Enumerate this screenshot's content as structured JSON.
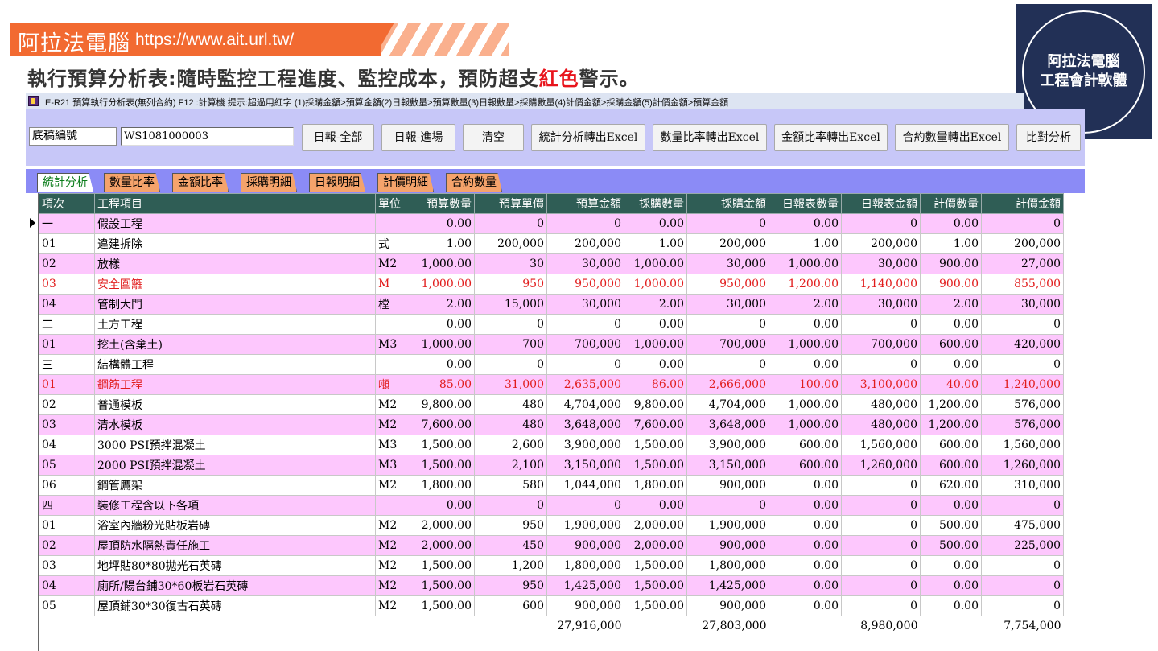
{
  "banner": {
    "title": "阿拉法電腦",
    "url": "https://www.ait.url.tw/"
  },
  "headline": {
    "part1": "執行預算分析表:隨時監控工程進度、監控成本，預防超支",
    "red": "紅色",
    "part2": "警示。"
  },
  "logo": {
    "line1": "阿拉法電腦",
    "line2": "工程會計軟體"
  },
  "window": {
    "title": "E-R21 預算執行分析表(無列合約)   F12 :計算機  提示:超過用紅字 (1)採購金額>預算金額(2)日報數量>預算數量(3)日報數量>採購數量(4)計價金額>採購金額(5)計價金額>預算金額"
  },
  "toolbar": {
    "label": "底稿編號",
    "input_value": "WS1081000003",
    "buttons": [
      "日報-全部",
      "日報-進場",
      "清空",
      "統計分析轉出Excel",
      "數量比率轉出Excel",
      "金額比率轉出Excel",
      "合約數量轉出Excel",
      "比對分析"
    ]
  },
  "tabs": [
    "統計分析",
    "數量比率",
    "金額比率",
    "採購明細",
    "日報明細",
    "計價明細",
    "合約數量"
  ],
  "grid": {
    "columns": [
      "項次",
      "工程項目",
      "單位",
      "預算數量",
      "預算單價",
      "預算金額",
      "採購數量",
      "採購金額",
      "日報表數量",
      "日報表金額",
      "計價數量",
      "計價金額"
    ],
    "rows": [
      {
        "c": [
          "一",
          "假設工程",
          "",
          "0.00",
          "0",
          "0",
          "0.00",
          "0",
          "0.00",
          "0",
          "0.00",
          "0"
        ],
        "style": "pink",
        "red": false
      },
      {
        "c": [
          "01",
          "違建拆除",
          "式",
          "1.00",
          "200,000",
          "200,000",
          "1.00",
          "200,000",
          "1.00",
          "200,000",
          "1.00",
          "200,000"
        ],
        "style": "white",
        "red": false
      },
      {
        "c": [
          "02",
          "放樣",
          "M2",
          "1,000.00",
          "30",
          "30,000",
          "1,000.00",
          "30,000",
          "1,000.00",
          "30,000",
          "900.00",
          "27,000"
        ],
        "style": "pink",
        "red": false
      },
      {
        "c": [
          "03",
          "安全圍籬",
          "M",
          "1,000.00",
          "950",
          "950,000",
          "1,000.00",
          "950,000",
          "1,200.00",
          "1,140,000",
          "900.00",
          "855,000"
        ],
        "style": "white",
        "red": true
      },
      {
        "c": [
          "04",
          "管制大門",
          "樘",
          "2.00",
          "15,000",
          "30,000",
          "2.00",
          "30,000",
          "2.00",
          "30,000",
          "2.00",
          "30,000"
        ],
        "style": "pink",
        "red": false
      },
      {
        "c": [
          "二",
          "土方工程",
          "",
          "0.00",
          "0",
          "0",
          "0.00",
          "0",
          "0.00",
          "0",
          "0.00",
          "0"
        ],
        "style": "white",
        "red": false
      },
      {
        "c": [
          "01",
          "挖土(含棄土)",
          "M3",
          "1,000.00",
          "700",
          "700,000",
          "1,000.00",
          "700,000",
          "1,000.00",
          "700,000",
          "600.00",
          "420,000"
        ],
        "style": "pink",
        "red": false
      },
      {
        "c": [
          "三",
          "結構體工程",
          "",
          "0.00",
          "0",
          "0",
          "0.00",
          "0",
          "0.00",
          "0",
          "0.00",
          "0"
        ],
        "style": "white",
        "red": false
      },
      {
        "c": [
          "01",
          "鋼筋工程",
          "噸",
          "85.00",
          "31,000",
          "2,635,000",
          "86.00",
          "2,666,000",
          "100.00",
          "3,100,000",
          "40.00",
          "1,240,000"
        ],
        "style": "pink",
        "red": true
      },
      {
        "c": [
          "02",
          "普通模板",
          "M2",
          "9,800.00",
          "480",
          "4,704,000",
          "9,800.00",
          "4,704,000",
          "1,000.00",
          "480,000",
          "1,200.00",
          "576,000"
        ],
        "style": "white",
        "red": false
      },
      {
        "c": [
          "03",
          "清水模板",
          "M2",
          "7,600.00",
          "480",
          "3,648,000",
          "7,600.00",
          "3,648,000",
          "1,000.00",
          "480,000",
          "1,200.00",
          "576,000"
        ],
        "style": "pink",
        "red": false
      },
      {
        "c": [
          "04",
          "3000 PSI預拌混凝土",
          "M3",
          "1,500.00",
          "2,600",
          "3,900,000",
          "1,500.00",
          "3,900,000",
          "600.00",
          "1,560,000",
          "600.00",
          "1,560,000"
        ],
        "style": "white",
        "red": false
      },
      {
        "c": [
          "05",
          "2000 PSI預拌混凝土",
          "M3",
          "1,500.00",
          "2,100",
          "3,150,000",
          "1,500.00",
          "3,150,000",
          "600.00",
          "1,260,000",
          "600.00",
          "1,260,000"
        ],
        "style": "pink",
        "red": false
      },
      {
        "c": [
          "06",
          "鋼管鷹架",
          "M2",
          "1,800.00",
          "580",
          "1,044,000",
          "1,800.00",
          "900,000",
          "0.00",
          "0",
          "620.00",
          "310,000"
        ],
        "style": "white",
        "red": false
      },
      {
        "c": [
          "四",
          "裝修工程含以下各項",
          "",
          "0.00",
          "0",
          "0",
          "0.00",
          "0",
          "0.00",
          "0",
          "0.00",
          "0"
        ],
        "style": "pink",
        "red": false
      },
      {
        "c": [
          "01",
          "浴室內牆粉光貼板岩磚",
          "M2",
          "2,000.00",
          "950",
          "1,900,000",
          "2,000.00",
          "1,900,000",
          "0.00",
          "0",
          "500.00",
          "475,000"
        ],
        "style": "white",
        "red": false
      },
      {
        "c": [
          "02",
          "屋頂防水隔熱責任施工",
          "M2",
          "2,000.00",
          "450",
          "900,000",
          "2,000.00",
          "900,000",
          "0.00",
          "0",
          "500.00",
          "225,000"
        ],
        "style": "pink",
        "red": false
      },
      {
        "c": [
          "03",
          "地坪貼80*80拋光石英磚",
          "M2",
          "1,500.00",
          "1,200",
          "1,800,000",
          "1,500.00",
          "1,800,000",
          "0.00",
          "0",
          "0.00",
          "0"
        ],
        "style": "white",
        "red": false
      },
      {
        "c": [
          "04",
          "廁所/陽台鋪30*60板岩石英磚",
          "M2",
          "1,500.00",
          "950",
          "1,425,000",
          "1,500.00",
          "1,425,000",
          "0.00",
          "0",
          "0.00",
          "0"
        ],
        "style": "pink",
        "red": false
      },
      {
        "c": [
          "05",
          "屋頂鋪30*30復古石英磚",
          "M2",
          "1,500.00",
          "600",
          "900,000",
          "1,500.00",
          "900,000",
          "0.00",
          "0",
          "0.00",
          "0"
        ],
        "style": "white",
        "red": false
      }
    ],
    "totals": [
      "",
      "",
      "",
      "",
      "",
      "27,916,000",
      "",
      "27,803,000",
      "",
      "8,980,000",
      "",
      "7,754,000"
    ]
  }
}
